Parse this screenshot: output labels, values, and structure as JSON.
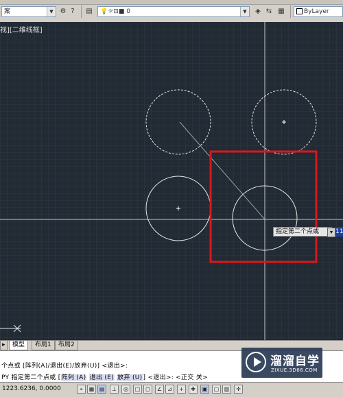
{
  "toolbar": {
    "left_combo_text": "案",
    "layer_combo_text": "0",
    "color_combo_text": "ByLayer"
  },
  "viewport": {
    "label": "视][二维线框]"
  },
  "tooltip": {
    "text": "指定第二个点或",
    "value": "11"
  },
  "tabs": [
    "模型",
    "布局1",
    "布局2"
  ],
  "command": {
    "line1": "个点或 [阵列(A)/退出(E)/放弃(U)] <退出>:",
    "line2_prefix": "PY 指定第二个点或 [",
    "opt1": "阵列",
    "opt1_key": "(A)",
    "opt2": "退出",
    "opt2_key": "(E)",
    "opt3": "放弃",
    "opt3_key": "(U)",
    "line2_suffix": "] <退出>: <正交 关>"
  },
  "status": {
    "coords": "1223.6236, 0.0000"
  },
  "watermark": {
    "brand": "溜溜自学",
    "url": "ZIXUE.3D66.COM"
  },
  "colors": {
    "canvas": "#222a34",
    "highlight_box": "#e0151a",
    "accent": "#1c3f9e"
  }
}
